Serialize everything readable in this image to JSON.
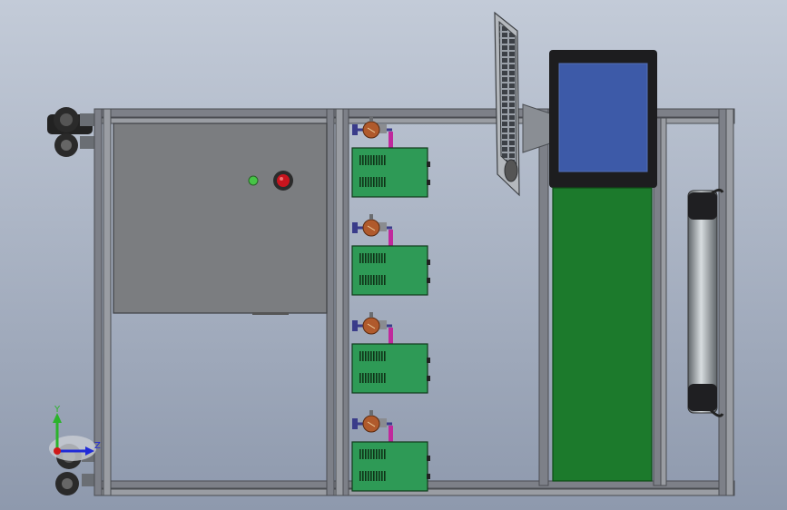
{
  "scene": {
    "background_top": "#c3cbd8",
    "background_bottom": "#8e99ad",
    "frame_color": "#7d8088",
    "cabinet_color": "#7b7d80",
    "psu_color": "#2e9a56",
    "monitor_screen_color": "#3d5aa8",
    "green_panel_color": "#1c7a2c"
  },
  "psu_units": [
    {
      "id": "psu-1"
    },
    {
      "id": "psu-2"
    },
    {
      "id": "psu-3"
    },
    {
      "id": "psu-4"
    }
  ],
  "indicators": {
    "green_light": "#46c446",
    "red_button": "#c8141e"
  },
  "triad": {
    "y_label": "Y",
    "z_label": "Z",
    "y_color": "#2bb32b",
    "z_color": "#1f2ad8",
    "x_color": "#d01818"
  }
}
